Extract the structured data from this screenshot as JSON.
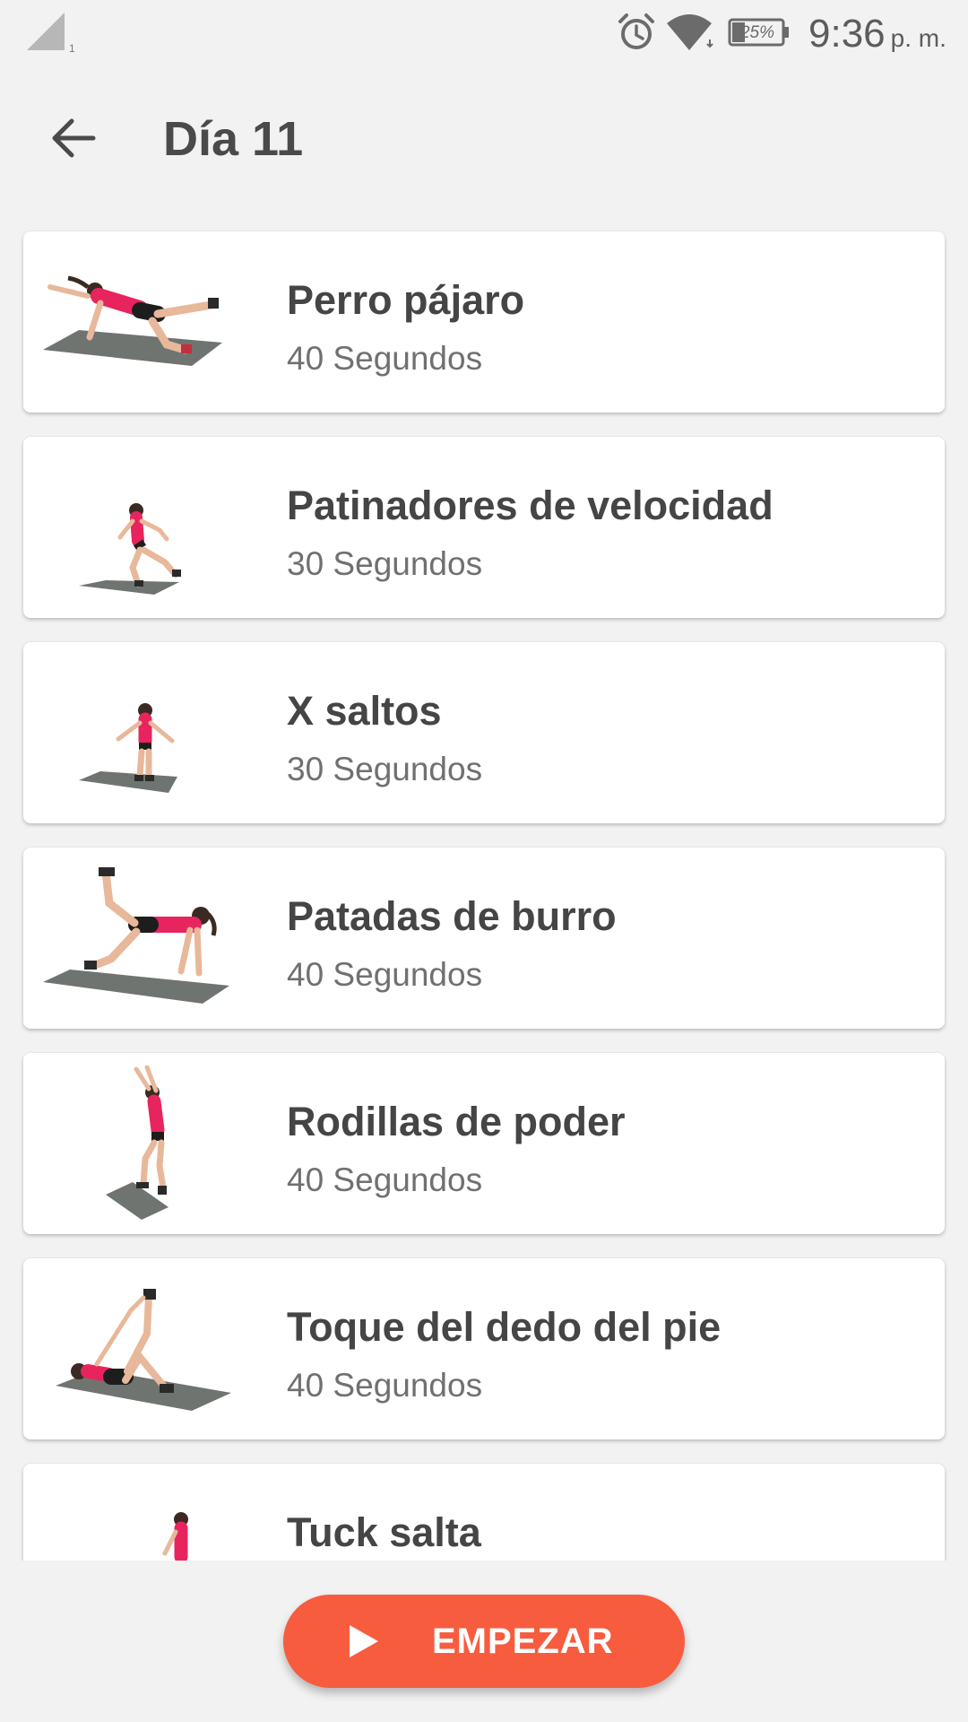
{
  "status_bar": {
    "battery": "25%",
    "time": "9:36",
    "ampm": "p. m.",
    "icons": [
      "signal-icon",
      "alarm-icon",
      "wifi-icon",
      "battery-icon"
    ]
  },
  "toolbar": {
    "back_icon": "arrow-back-icon",
    "title": "Día 11"
  },
  "exercises": [
    {
      "name": "Perro pájaro",
      "duration": "40 Segundos",
      "thumbnail": "bird-dog-pose"
    },
    {
      "name": "Patinadores de velocidad",
      "duration": "30 Segundos",
      "thumbnail": "speed-skater-pose"
    },
    {
      "name": "X saltos",
      "duration": "30 Segundos",
      "thumbnail": "x-jump-pose"
    },
    {
      "name": "Patadas de burro",
      "duration": "40 Segundos",
      "thumbnail": "donkey-kick-pose"
    },
    {
      "name": "Rodillas de poder",
      "duration": "40 Segundos",
      "thumbnail": "power-knee-pose"
    },
    {
      "name": "Toque del dedo del pie",
      "duration": "40 Segundos",
      "thumbnail": "toe-touch-pose"
    },
    {
      "name": "Tuck salta",
      "duration": "",
      "thumbnail": "tuck-jump-pose"
    }
  ],
  "start_button": {
    "label": "EMPEZAR",
    "icon": "play-icon"
  },
  "colors": {
    "accent": "#f75c3f",
    "background": "#f2f2f2",
    "card": "#ffffff",
    "title_text": "#454545",
    "secondary_text": "#707070",
    "athlete_top": "#e8245f",
    "mat": "#6f7471"
  }
}
